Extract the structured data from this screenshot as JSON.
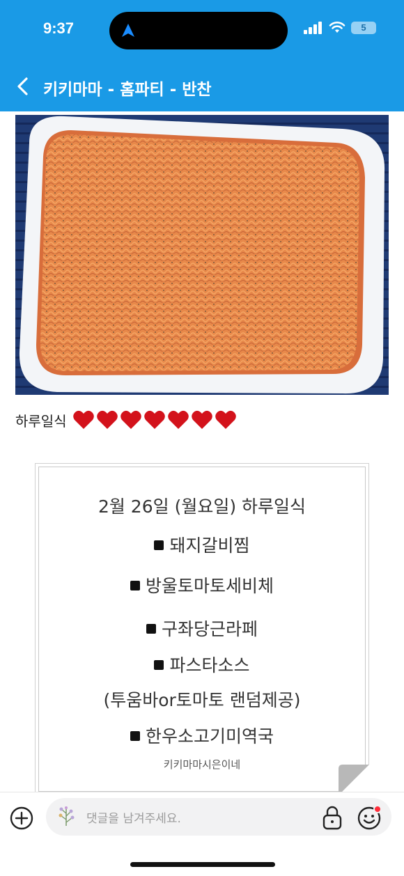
{
  "status_bar": {
    "time": "9:37",
    "battery": "5"
  },
  "nav": {
    "title": "키키마마 - 홈파티 - 반찬"
  },
  "post": {
    "caption": "하루일식",
    "hearts_count": 7
  },
  "menu_card": {
    "date_line": "2월 26일 (월요일) 하루일식",
    "items": [
      "돼지갈비찜",
      "방울토마토세비체",
      "구좌당근라페",
      "파스타소스",
      "(투움바or토마토 랜덤제공)",
      "한우소고기미역국"
    ],
    "signature": "키키마마시은이네"
  },
  "comment_bar": {
    "placeholder": "댓글을 남겨주세요."
  },
  "colors": {
    "brand": "#1a9ae6",
    "heart": "#d3121b"
  },
  "icons": [
    "location-arrow-icon",
    "signal-icon",
    "wifi-icon",
    "battery-icon",
    "back-chevron-icon",
    "heart-icon",
    "plus-circle-icon",
    "lock-icon",
    "emoji-icon"
  ]
}
